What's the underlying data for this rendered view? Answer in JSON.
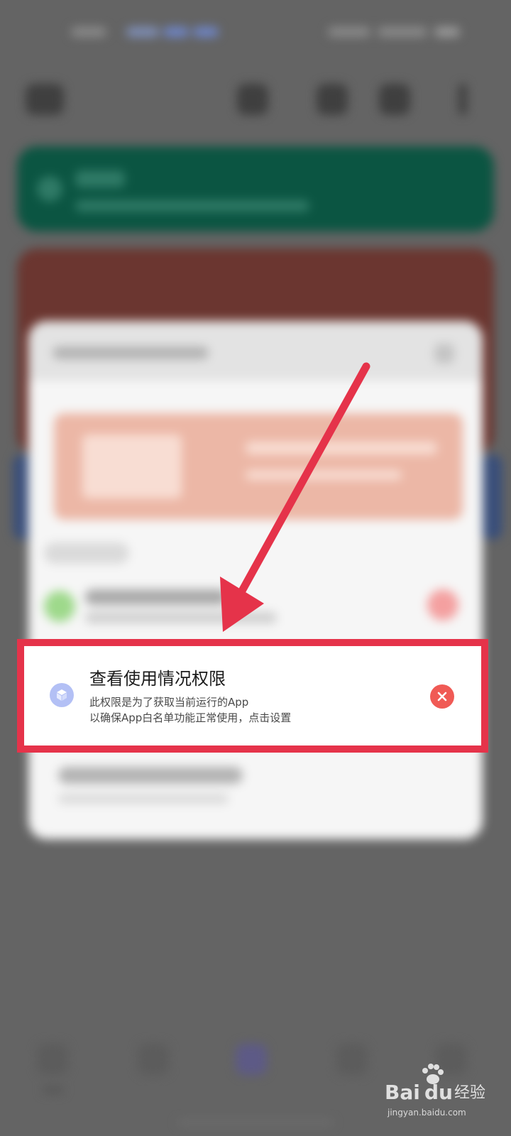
{
  "permission_toast": {
    "title": "查看使用情况权限",
    "desc_line1": "此权限是为了获取当前运行的App",
    "desc_line2": "以确保App白名单功能正常使用，点击设置",
    "icon": "cube-icon",
    "close_icon": "close-icon"
  },
  "annotation": {
    "arrow_color": "#e5334a",
    "highlight_color": "#e5334a"
  },
  "watermark": {
    "brand": "Baidu经验",
    "url": "jingyan.baidu.com"
  },
  "colors": {
    "backdrop": "#646464",
    "close_button": "#f05a55",
    "permission_icon": "#b3c0f5"
  }
}
